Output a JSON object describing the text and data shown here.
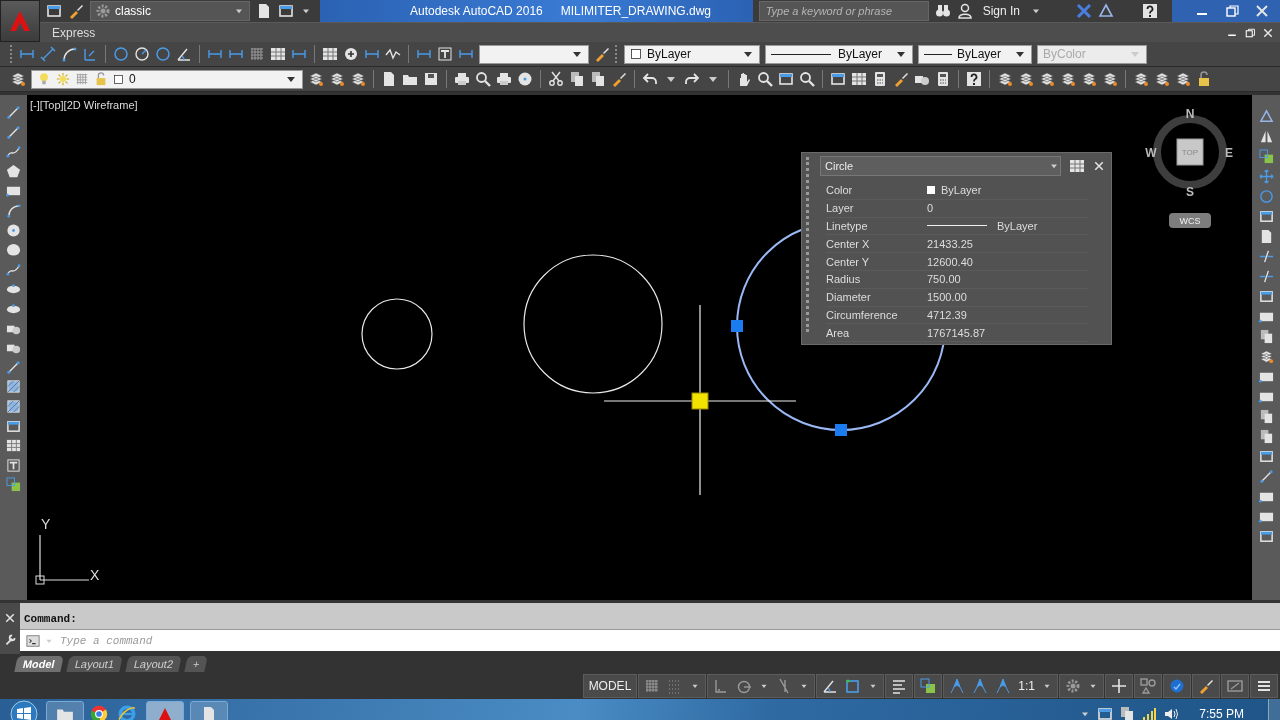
{
  "title_bar": {
    "workspace": "classic",
    "app_title": "Autodesk AutoCAD 2016",
    "file_name": "MILIMITER_DRAWING.dwg",
    "search": {
      "placeholder": "Type a keyword or phrase"
    },
    "sign_in": "Sign In"
  },
  "menu": [
    "Express"
  ],
  "properties_toolbar": {
    "color_setting": "ByLayer",
    "linetype": "ByLayer",
    "lineweight": "ByLayer",
    "plot_style": {
      "value": "ByColor",
      "disabled": true
    }
  },
  "layer_toolbar": {
    "layer": "0"
  },
  "viewport": {
    "label": "[-][Top][2D Wireframe]"
  },
  "viewcube": {
    "north": "N",
    "south": "S",
    "east": "E",
    "west": "W",
    "face": "TOP",
    "ucs_menu": "WCS"
  },
  "ucs_icon": {
    "x": "X",
    "y": "Y"
  },
  "properties_panel": {
    "object": "Circle",
    "rows": [
      {
        "label": "Color",
        "value": "ByLayer",
        "kind": "color"
      },
      {
        "label": "Layer",
        "value": "0",
        "kind": "text"
      },
      {
        "label": "Linetype",
        "value": "ByLayer",
        "kind": "linetype"
      },
      {
        "label": "Center X",
        "value": "21433.25",
        "kind": "text"
      },
      {
        "label": "Center Y",
        "value": "12600.40",
        "kind": "text"
      },
      {
        "label": "Radius",
        "value": "750.00",
        "kind": "text"
      },
      {
        "label": "Diameter",
        "value": "1500.00",
        "kind": "text"
      },
      {
        "label": "Circumference",
        "value": "4712.39",
        "kind": "text"
      },
      {
        "label": "Area",
        "value": "1767145.87",
        "kind": "text"
      }
    ]
  },
  "command_line": {
    "history": "Command:",
    "placeholder": "Type a command"
  },
  "layout_tabs": [
    {
      "label": "Model",
      "selected": true
    },
    {
      "label": "Layout1",
      "selected": false
    },
    {
      "label": "Layout2",
      "selected": false
    }
  ],
  "add_tab": "+",
  "status_bar": {
    "space": "MODEL",
    "annotation_scale": "1:1"
  },
  "taskbar": {
    "time": "7:55 PM"
  }
}
